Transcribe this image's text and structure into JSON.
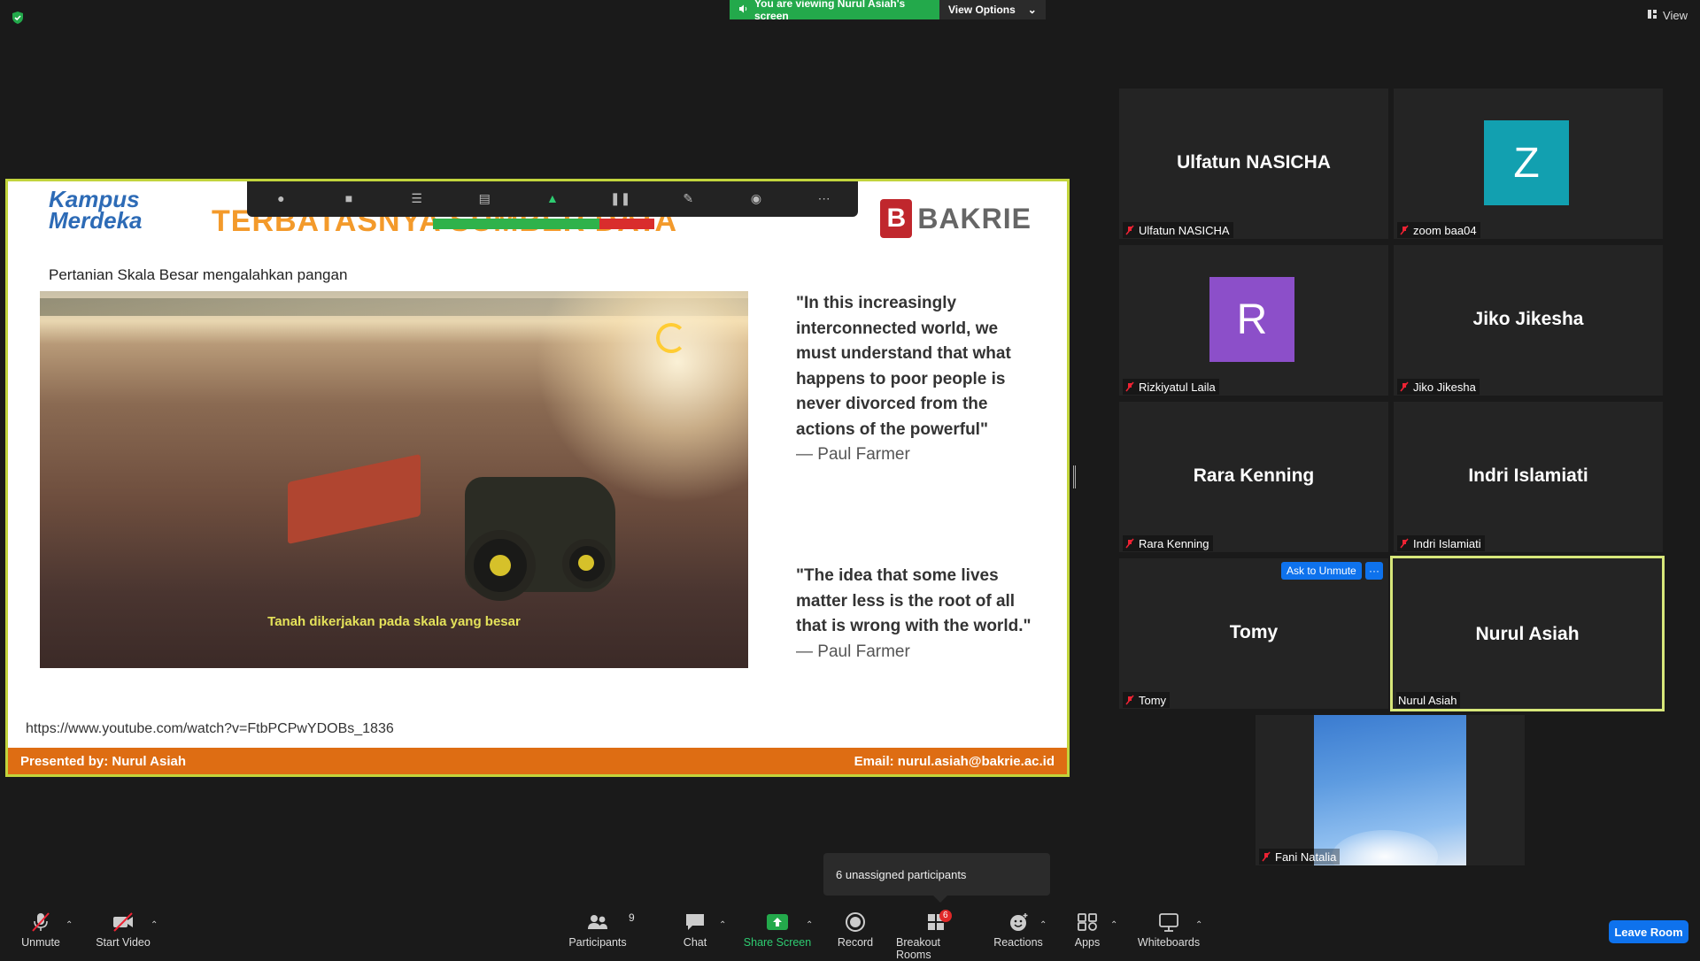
{
  "top_bar": {
    "banner_text": "You are viewing Nurul Asiah's screen",
    "view_options_label": "View Options",
    "view_label": "View"
  },
  "slide": {
    "logo_line1": "Kampus",
    "logo_line2": "Merdeka",
    "title": "TERBATASNYA SUMBER DATA",
    "bakrie_logo": "BAKRIE",
    "subtitle": "Pertanian Skala Besar mengalahkan pangan",
    "photo_caption": "Tanah dikerjakan pada skala yang besar",
    "quote1_text": "\"In this increasingly interconnected world, we must understand that what happens to poor people is never divorced from the actions of the powerful\"",
    "quote1_author": "— Paul Farmer",
    "quote2_text": "\"The idea that some lives matter less is the root of all that is wrong with the world.\"",
    "quote2_author": "— Paul Farmer",
    "url": "https://www.youtube.com/watch?v=FtbPCPwYDOBs_1836",
    "footer_left": "Presented by: Nurul Asiah",
    "footer_right": "Email: nurul.asiah@bakrie.ac.id"
  },
  "participants_tiles": [
    {
      "display": "Ulfatun NASICHA",
      "label": "Ulfatun NASICHA"
    },
    {
      "display": "Z",
      "label": "zoom baa04",
      "avatar_color": "#12a0b0"
    },
    {
      "display": "R",
      "label": "Rizkiyatul Laila",
      "avatar_color": "#8c4fc9"
    },
    {
      "display": "Jiko Jikesha",
      "label": "Jiko Jikesha"
    },
    {
      "display": "Rara Kenning",
      "label": "Rara Kenning"
    },
    {
      "display": "Indri Islamiati",
      "label": "Indri Islamiati"
    },
    {
      "display": "Tomy",
      "label": "Tomy"
    },
    {
      "display": "Nurul Asiah",
      "label": "Nurul Asiah"
    },
    {
      "display": "",
      "label": "Fani Natalia"
    }
  ],
  "tile_controls": {
    "ask_unmute": "Ask to Unmute",
    "more": "···"
  },
  "popup": {
    "unassigned_text": "6 unassigned participants"
  },
  "toolbar": {
    "unmute": "Unmute",
    "start_video": "Start Video",
    "participants": "Participants",
    "participants_count": "9",
    "chat": "Chat",
    "share_screen": "Share Screen",
    "record": "Record",
    "breakout_rooms": "Breakout Rooms",
    "breakout_count": "6",
    "reactions": "Reactions",
    "apps": "Apps",
    "whiteboards": "Whiteboards",
    "leave_room": "Leave Room"
  },
  "colors": {
    "accent_blue": "#0e72ed",
    "share_green": "#23a94b",
    "active_speaker_border": "#d7e77a",
    "share_border": "#c2d43c",
    "slide_footer": "#de6d13",
    "slide_title": "#f39a2b"
  },
  "icons": [
    "shield-icon",
    "speaker-icon",
    "chevron-down-icon",
    "view-grid-icon",
    "mic-muted-icon",
    "video-off-icon",
    "participants-icon",
    "chat-icon",
    "share-screen-icon",
    "record-icon",
    "breakout-rooms-icon",
    "reactions-icon",
    "apps-icon",
    "whiteboard-icon"
  ]
}
